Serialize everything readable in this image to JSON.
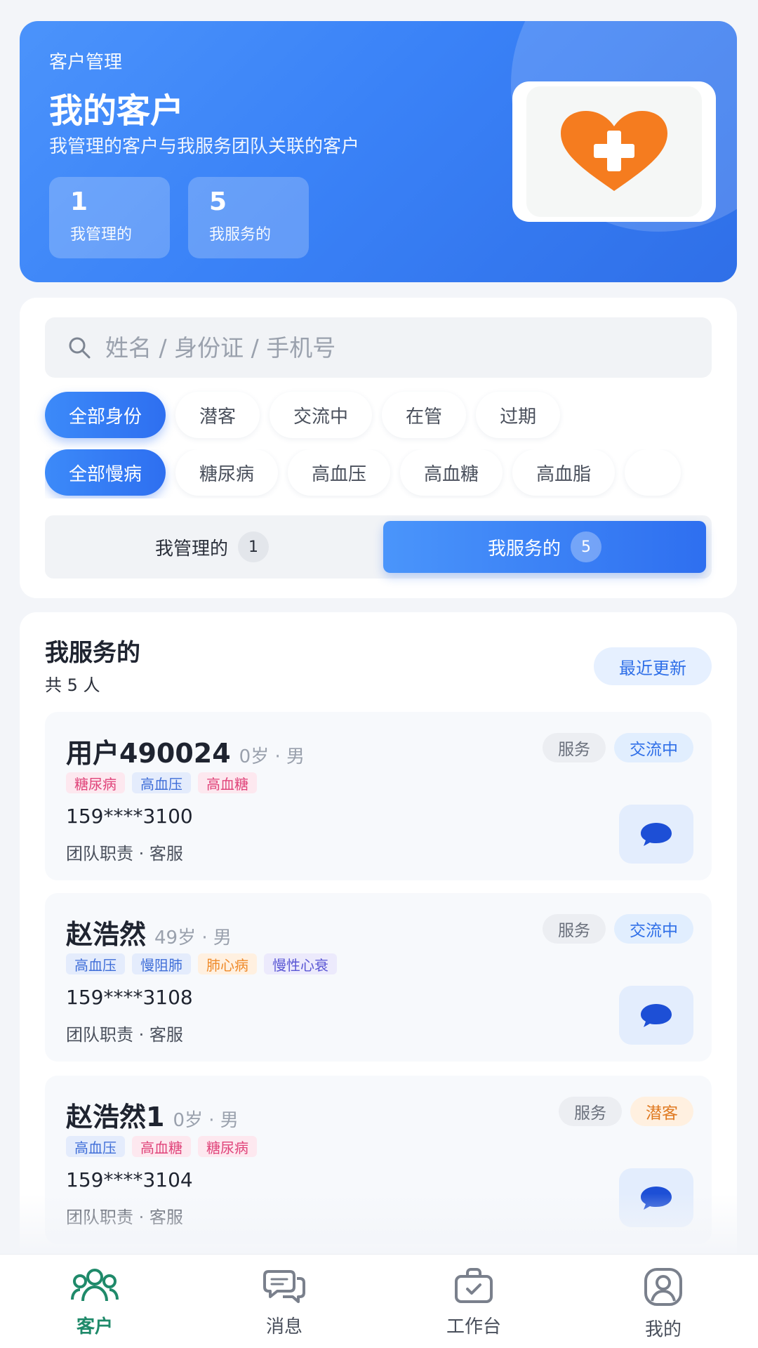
{
  "hero": {
    "subtitle": "客户管理",
    "title": "我的客户",
    "description": "我管理的客户与我服务团队关联的客户",
    "stats": [
      {
        "value": "1",
        "label": "我管理的"
      },
      {
        "value": "5",
        "label": "我服务的"
      }
    ]
  },
  "search": {
    "placeholder": "姓名 / 身份证 / 手机号",
    "value": ""
  },
  "identity_filters": [
    "全部身份",
    "潜客",
    "交流中",
    "在管",
    "过期"
  ],
  "disease_filters": [
    "全部慢病",
    "糖尿病",
    "高血压",
    "高血糖",
    "高血脂"
  ],
  "segment": {
    "managed": {
      "label": "我管理的",
      "count": "1"
    },
    "served": {
      "label": "我服务的",
      "count": "5"
    },
    "selected": "served"
  },
  "list": {
    "title": "我服务的",
    "count_text": "共 5 人",
    "sort_label": "最近更新",
    "customers": [
      {
        "name": "用户490024",
        "meta": "0岁 · 男",
        "tags": [
          {
            "text": "糖尿病",
            "color": "pink"
          },
          {
            "text": "高血压",
            "color": "blue"
          },
          {
            "text": "高血糖",
            "color": "pink"
          }
        ],
        "phone": "159****3100",
        "role": "团队职责 · 客服",
        "type_badge": "服务",
        "status_badge": "交流中",
        "status_color": "blue"
      },
      {
        "name": "赵浩然",
        "meta": "49岁 · 男",
        "tags": [
          {
            "text": "高血压",
            "color": "blue"
          },
          {
            "text": "慢阻肺",
            "color": "blue"
          },
          {
            "text": "肺心病",
            "color": "orange"
          },
          {
            "text": "慢性心衰",
            "color": "purple"
          }
        ],
        "phone": "159****3108",
        "role": "团队职责 · 客服",
        "type_badge": "服务",
        "status_badge": "交流中",
        "status_color": "blue"
      },
      {
        "name": "赵浩然1",
        "meta": "0岁 · 男",
        "tags": [
          {
            "text": "高血压",
            "color": "blue"
          },
          {
            "text": "高血糖",
            "color": "pink"
          },
          {
            "text": "糖尿病",
            "color": "pink"
          }
        ],
        "phone": "159****3104",
        "role": "团队职责 · 客服",
        "type_badge": "服务",
        "status_badge": "潜客",
        "status_color": "orange"
      }
    ]
  },
  "tabbar": {
    "items": [
      {
        "label": "客户",
        "icon": "customers-icon",
        "active": true
      },
      {
        "label": "消息",
        "icon": "messages-icon",
        "active": false
      },
      {
        "label": "工作台",
        "icon": "workbench-icon",
        "active": false
      },
      {
        "label": "我的",
        "icon": "profile-icon",
        "active": false
      }
    ]
  },
  "colors": {
    "primary": "#2f6fe8",
    "accent_green": "#1f8a6a",
    "heart_orange": "#f57c1f"
  }
}
